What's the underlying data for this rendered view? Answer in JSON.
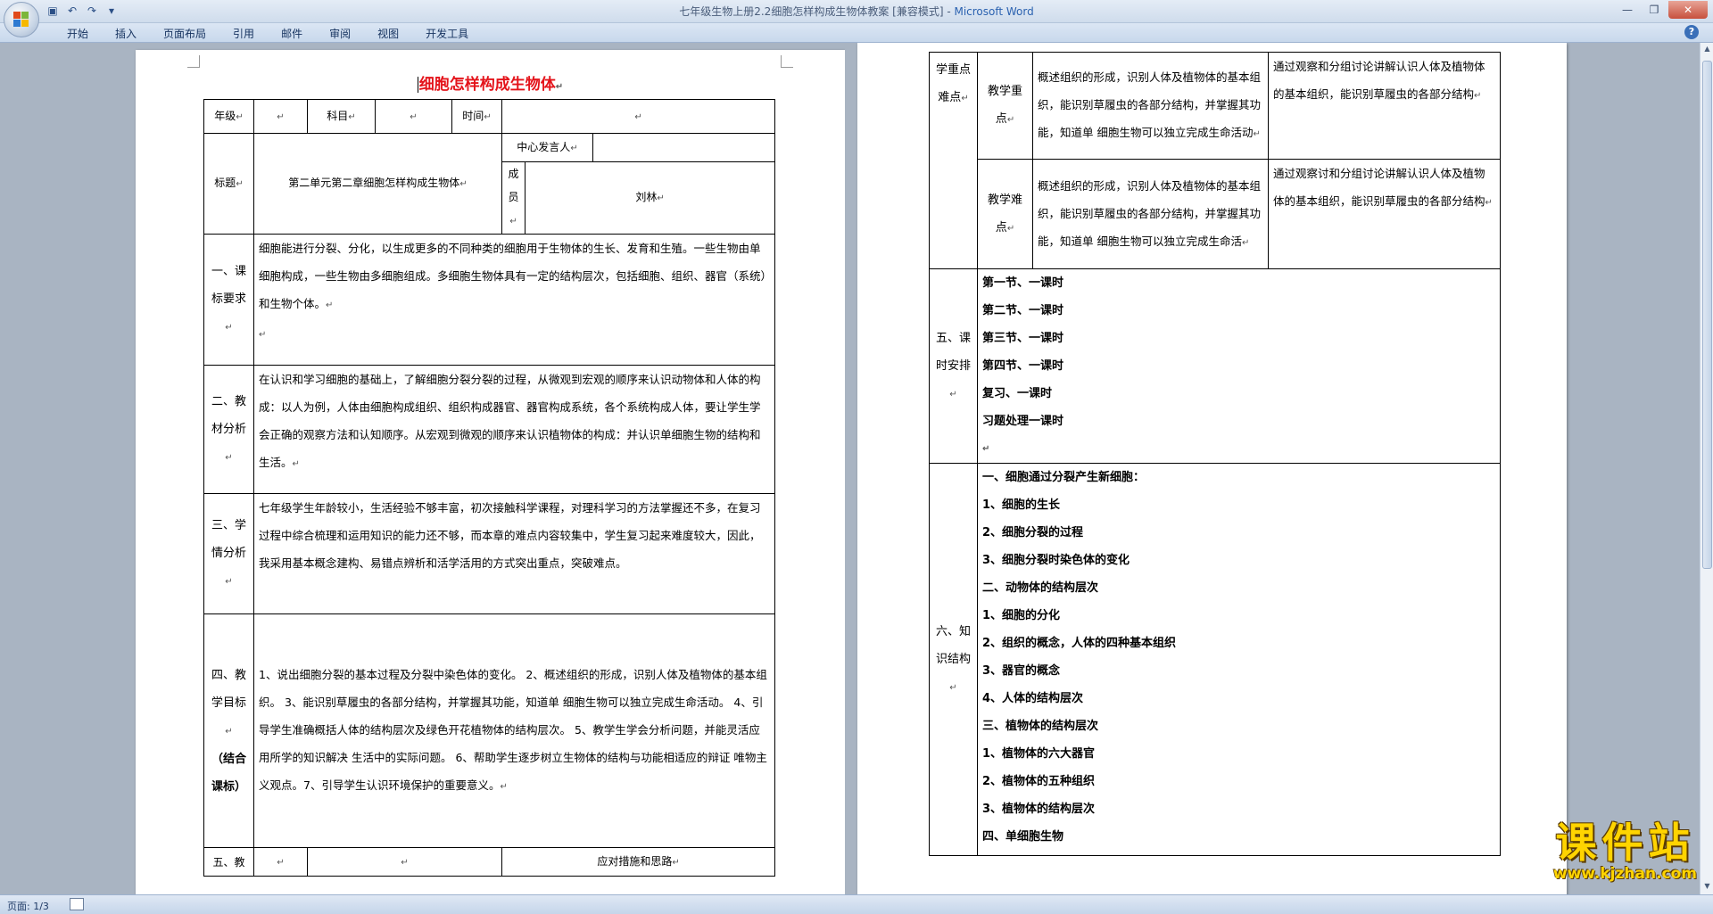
{
  "window": {
    "title": "七年级生物上册2.2细胞怎样构成生物体教案 [兼容模式] - ",
    "app_name": "Microsoft Word"
  },
  "ribbon": {
    "tabs": [
      "开始",
      "插入",
      "页面布局",
      "引用",
      "邮件",
      "审阅",
      "视图",
      "开发工具"
    ]
  },
  "doc": {
    "title": "细胞怎样构成生物体",
    "header_row1": {
      "grade_label": "年级",
      "subject_label": "科目",
      "time_label": "时间"
    },
    "header_row2": {
      "topic_label": "标题",
      "topic_value": "第二单元第二章细胞怎样构成生物体",
      "speaker_label": "中心发言人",
      "member_label": "成员",
      "member_value": "刘林"
    },
    "sections": {
      "s1": {
        "label": "一、课标要求",
        "text": "细胞能进行分裂、分化，以生成更多的不同种类的细胞用于生物体的生长、发育和生殖。一些生物由单细胞构成，一些生物由多细胞组成。多细胞生物体具有一定的结构层次，包括细胞、组织、器官（系统）和生物个体。"
      },
      "s2": {
        "label": "二、教材分析",
        "text": "在认识和学习细胞的基础上，了解细胞分裂分裂的过程，从微观到宏观的顺序来认识动物体和人体的构成：以人为例，人体由细胞构成组织、组织构成器官、器官构成系统，各个系统构成人体，要让学生学会正确的观察方法和认知顺序。从宏观到微观的顺序来认识植物体的构成：并认识单细胞生物的结构和生活。"
      },
      "s3": {
        "label": "三、学情分析",
        "text": "七年级学生年龄较小，生活经验不够丰富，初次接触科学课程，对理科学习的方法掌握还不多，在复习过程中综合梳理和运用知识的能力还不够，而本章的难点内容较集中，学生复习起来难度较大，因此，我采用基本概念建构、易错点辨析和活学活用的方式突出重点，突破难点。"
      },
      "s4": {
        "label": "四、教学目标",
        "label_extra": "（结合课标）",
        "text": "1、说出细胞分裂的基本过程及分裂中染色体的变化。 2、概述组织的形成，识别人体及植物体的基本组织。 3、能识别草履虫的各部分结构，并掌握其功能，知道单 细胞生物可以独立完成生命活动。 4、引导学生准确概括人体的结构层次及绿色开花植物体的结构层次。 5、教学生学会分析问题，并能灵活应用所学的知识解决 生活中的实际问题。 6、帮助学生逐步树立生物体的结构与功能相适应的辩证 唯物主义观点。7、引导学生认识环境保护的重要意义。"
      },
      "s5_bottom": {
        "label": "五、教",
        "measure_label": "应对措施和思路"
      }
    },
    "right": {
      "key_label": "学重点难点",
      "focus": {
        "label": "教学重点",
        "content": "概述组织的形成，识别人体及植物体的基本组织，能识别草履虫的各部分结构，并掌握其功能，知道单 细胞生物可以独立完成生命活动",
        "measure": "通过观察和分组讨论讲解认识人体及植物体的基本组织，能识别草履虫的各部分结构"
      },
      "difficulty": {
        "label": "教学难点",
        "content": "概述组织的形成，识别人体及植物体的基本组织，能识别草履虫的各部分结构，并掌握其功能，知道单 细胞生物可以独立完成生命活",
        "measure": "通过观察讨和分组讨论讲解认识人体及植物体的基本组织，能识别草履虫的各部分结构"
      },
      "schedule": {
        "label": "五、课时安排",
        "items": [
          "第一节、一课时",
          "第二节、一课时",
          "第三节、一课时",
          "第四节、一课时",
          "复习、一课时",
          "习题处理一课时"
        ]
      },
      "knowledge": {
        "label": "六、知识结构",
        "items": [
          "一、细胞通过分裂产生新细胞：",
          "1、细胞的生长",
          "2、细胞分裂的过程",
          "3、细胞分裂时染色体的变化",
          "二、动物体的结构层次",
          "1、细胞的分化",
          "2、组织的概念，人体的四种基本组织",
          "3、器官的概念",
          "4、人体的结构层次",
          "三、植物体的结构层次",
          "1、植物体的六大器官",
          "2、植物体的五种组织",
          "3、植物体的结构层次",
          "四、单细胞生物"
        ]
      }
    }
  },
  "status": {
    "page": "页面: 1/3"
  },
  "watermark": {
    "big": "课件站",
    "small": "www.kjzhan.com"
  },
  "colors": {
    "title_red": "#e4141b",
    "workspace": "#a9b4c2",
    "watermark": "#ffd400"
  }
}
